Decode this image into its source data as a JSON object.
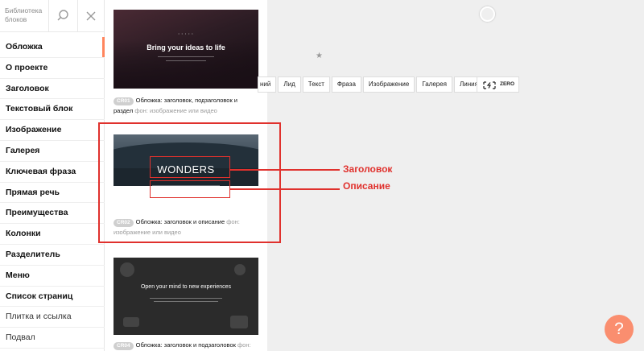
{
  "sidebar": {
    "title": "Библиотека блоков",
    "items": [
      {
        "label": "Обложка",
        "active": true
      },
      {
        "label": "О проекте"
      },
      {
        "label": "Заголовок"
      },
      {
        "label": "Текстовый блок"
      },
      {
        "label": "Изображение"
      },
      {
        "label": "Галерея"
      },
      {
        "label": "Ключевая фраза"
      },
      {
        "label": "Прямая речь"
      },
      {
        "label": "Преимущества"
      },
      {
        "label": "Колонки"
      },
      {
        "label": "Разделитель"
      },
      {
        "label": "Меню"
      },
      {
        "label": "Список страниц"
      },
      {
        "label": "Плитка и ссылка"
      },
      {
        "label": "Подвал"
      }
    ]
  },
  "icons": {
    "search": "search-icon",
    "close": "close-icon",
    "star": "star-icon",
    "zero": "zero-block-icon"
  },
  "cards": [
    {
      "badge": "CR01",
      "thumb_title": "Bring your ideas to life",
      "desc": "Обложка: заголовок, подзаголовок и раздел",
      "note": "фон: изображение или видео"
    },
    {
      "badge": "CR02",
      "thumb_title": "WONDERS",
      "desc": "Обложка: заголовок и описание",
      "note": "фон: изображение или видео"
    },
    {
      "badge": "CR04",
      "thumb_title": "Open your mind to new experiences",
      "desc": "Обложка: заголовок и подзаголовок",
      "note": "фон: изобр..."
    }
  ],
  "toolbar": {
    "categories": [
      "ний",
      "Лид",
      "Текст",
      "Фраза",
      "Изображение",
      "Галерея",
      "Линия"
    ],
    "zero_label": "ZERO"
  },
  "annotations": {
    "title_label": "Заголовок",
    "desc_label": "Описание"
  },
  "help": {
    "label": "?"
  },
  "colors": {
    "accent": "#ff855d",
    "annotation": "#e0312d",
    "help": "#fa8e6f"
  }
}
